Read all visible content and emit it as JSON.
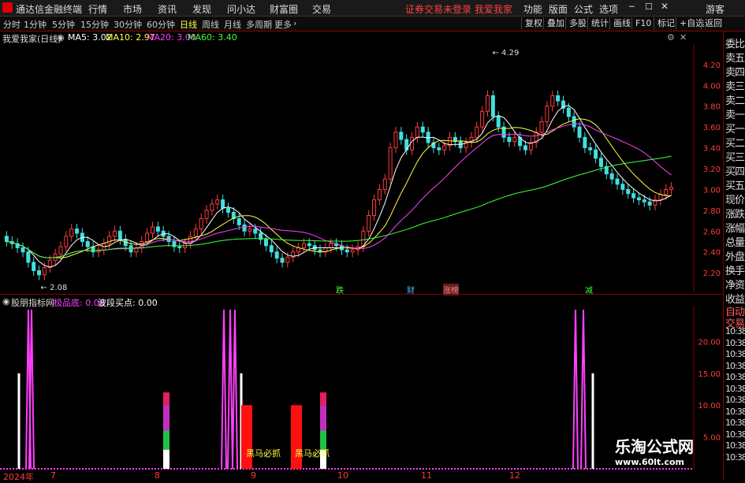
{
  "menubar": {
    "app_name": "通达信金融终端",
    "menus": [
      "行情",
      "市场",
      "资讯",
      "发现",
      "问小达",
      "财富圈",
      "交易"
    ],
    "status_center": "证券交易未登录  我爱我家",
    "right_menus": [
      "功能",
      "版面",
      "公式",
      "选项"
    ],
    "window_icons": [
      "minimize-icon",
      "maximize-icon",
      "close-icon"
    ],
    "user": "游客"
  },
  "toolbar": {
    "periods": [
      "分时",
      "1分钟",
      "5分钟",
      "15分钟",
      "30分钟",
      "60分钟",
      "日线",
      "周线",
      "月线",
      "多周期",
      "更多"
    ],
    "active_period": "日线",
    "right_buttons": [
      "复权",
      "叠加",
      "多股",
      "统计",
      "画线",
      "F10",
      "标记",
      "+自选",
      "返回"
    ]
  },
  "main_chart": {
    "title": "我爱我家(日线)",
    "ma": [
      {
        "label": "MA5: 3.02",
        "color": "#ffffff"
      },
      {
        "label": "MA10: 2.97",
        "color": "#ffff00"
      },
      {
        "label": "MA20: 3.00",
        "color": "#ff40ff"
      },
      {
        "label": "MA60: 3.40",
        "color": "#40ff40"
      }
    ],
    "high_label": "4.29",
    "low_label": "2.08",
    "markers": [
      {
        "text": "跌",
        "color": "#40ff40"
      },
      {
        "text": "财",
        "color": "#40c0ff"
      },
      {
        "text": "涨榜",
        "color": "#ff8080"
      },
      {
        "text": "减",
        "color": "#40ff40"
      }
    ]
  },
  "chart_data": [
    {
      "type": "candlestick",
      "title": "我爱我家(日线)",
      "ylim": [
        2.05,
        4.35
      ],
      "yticks": [
        "4.20",
        "4.00",
        "3.80",
        "3.60",
        "3.40",
        "3.20",
        "3.00",
        "2.80",
        "2.60",
        "2.40",
        "2.20"
      ],
      "close": [
        2.5,
        2.48,
        2.44,
        2.4,
        2.3,
        2.22,
        2.18,
        2.25,
        2.32,
        2.38,
        2.45,
        2.55,
        2.62,
        2.58,
        2.5,
        2.45,
        2.4,
        2.42,
        2.48,
        2.55,
        2.6,
        2.52,
        2.46,
        2.4,
        2.44,
        2.5,
        2.58,
        2.64,
        2.6,
        2.55,
        2.5,
        2.45,
        2.44,
        2.48,
        2.55,
        2.62,
        2.72,
        2.8,
        2.86,
        2.9,
        2.82,
        2.78,
        2.72,
        2.66,
        2.6,
        2.62,
        2.58,
        2.52,
        2.46,
        2.4,
        2.34,
        2.3,
        2.35,
        2.4,
        2.44,
        2.48,
        2.46,
        2.42,
        2.4,
        2.44,
        2.48,
        2.46,
        2.42,
        2.4,
        2.42,
        2.45,
        2.6,
        2.75,
        2.9,
        3.0,
        3.1,
        3.4,
        3.55,
        3.48,
        3.38,
        3.5,
        3.6,
        3.55,
        3.45,
        3.4,
        3.38,
        3.42,
        3.5,
        3.46,
        3.4,
        3.45,
        3.5,
        3.6,
        3.75,
        3.9,
        3.7,
        3.6,
        3.5,
        3.46,
        3.5,
        3.42,
        3.38,
        3.45,
        3.55,
        3.65,
        3.8,
        3.9,
        3.85,
        3.78,
        3.7,
        3.6,
        3.5,
        3.4,
        3.38,
        3.3,
        3.22,
        3.15,
        3.1,
        3.05,
        3.0,
        2.96,
        2.92,
        2.9,
        2.88,
        2.85,
        2.9,
        2.95,
        3.0,
        3.02
      ],
      "open": [
        2.55,
        2.5,
        2.48,
        2.44,
        2.4,
        2.3,
        2.22,
        2.18,
        2.25,
        2.32,
        2.38,
        2.45,
        2.55,
        2.62,
        2.58,
        2.5,
        2.45,
        2.4,
        2.42,
        2.48,
        2.55,
        2.6,
        2.52,
        2.46,
        2.4,
        2.44,
        2.5,
        2.58,
        2.64,
        2.6,
        2.55,
        2.5,
        2.45,
        2.44,
        2.48,
        2.55,
        2.62,
        2.72,
        2.8,
        2.86,
        2.9,
        2.82,
        2.78,
        2.72,
        2.66,
        2.6,
        2.62,
        2.58,
        2.52,
        2.46,
        2.4,
        2.34,
        2.3,
        2.35,
        2.4,
        2.44,
        2.48,
        2.46,
        2.42,
        2.4,
        2.44,
        2.48,
        2.46,
        2.42,
        2.4,
        2.42,
        2.45,
        2.6,
        2.75,
        2.9,
        3.0,
        3.1,
        3.4,
        3.55,
        3.48,
        3.38,
        3.5,
        3.6,
        3.55,
        3.45,
        3.4,
        3.38,
        3.42,
        3.5,
        3.46,
        3.4,
        3.45,
        3.5,
        3.6,
        3.75,
        3.9,
        3.7,
        3.6,
        3.5,
        3.46,
        3.5,
        3.42,
        3.38,
        3.45,
        3.55,
        3.65,
        3.8,
        3.9,
        3.85,
        3.78,
        3.7,
        3.6,
        3.5,
        3.4,
        3.38,
        3.3,
        3.22,
        3.15,
        3.1,
        3.05,
        3.0,
        2.96,
        2.92,
        2.9,
        2.88,
        2.85,
        2.9,
        2.95,
        3.0
      ]
    },
    {
      "type": "bar",
      "title": "股朋指标网",
      "legend": [
        {
          "label": "极品底: 0.00",
          "color": "#ff40ff"
        },
        {
          "label": "波段买点: 0.00",
          "color": "#ffffff"
        }
      ],
      "ylim": [
        0,
        25
      ],
      "yticks": [
        "20.00",
        "15.00",
        "10.00",
        "5.00"
      ],
      "xticks": [
        "2024年",
        "7",
        "8",
        "9",
        "10",
        "11",
        "12"
      ],
      "annotations": [
        "黑马必抓",
        "黑马必抓"
      ]
    }
  ],
  "sidebar": {
    "top_items": [
      "委比",
      "卖五",
      "卖四",
      "卖三",
      "卖二",
      "卖一",
      "买一",
      "买二",
      "买三",
      "买四",
      "买五",
      "现价",
      "涨跌",
      "涨幅",
      "总量",
      "外盘",
      "换手",
      "净资",
      "收益"
    ],
    "bottom_items": [
      "自动",
      "交易",
      "10:38",
      "10:38",
      "10:38",
      "10:38",
      "10:38",
      "10:38",
      "10:38",
      "10:38",
      "10:38",
      "10:38",
      "10:38",
      "10:38"
    ]
  },
  "watermark": {
    "line1": "乐淘公式网",
    "line2": "www.60lt.com"
  }
}
